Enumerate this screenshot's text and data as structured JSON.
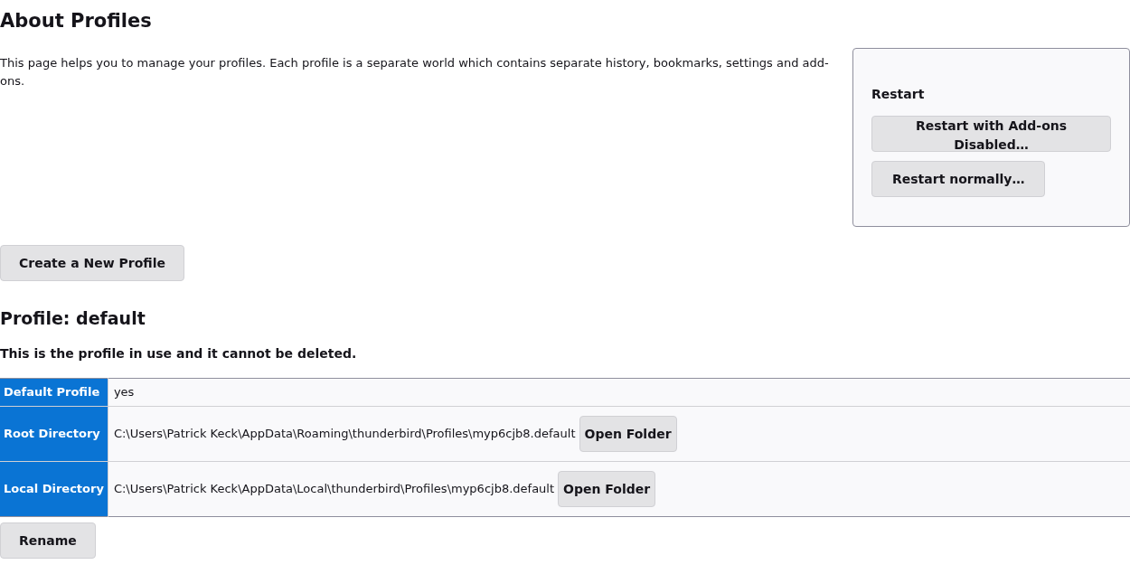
{
  "title": "About Profiles",
  "intro": "This page helps you to manage your profiles. Each profile is a separate world which contains separate history, bookmarks, settings and add-ons.",
  "restart": {
    "title": "Restart",
    "buttons": [
      "Restart with Add-ons Disabled…",
      "Restart normally…"
    ]
  },
  "create_button": "Create a New Profile",
  "profile": {
    "title": "Profile: default",
    "note": "This is the profile in use and it cannot be deleted.",
    "rows": [
      {
        "label": "Default Profile",
        "value": "yes"
      },
      {
        "label": "Root Directory",
        "value": "C:\\Users\\Patrick Keck\\AppData\\Roaming\\thunderbird\\Profiles\\myp6cjb8.default",
        "button": "Open Folder"
      },
      {
        "label": "Local Directory",
        "value": "C:\\Users\\Patrick Keck\\AppData\\Local\\thunderbird\\Profiles\\myp6cjb8.default",
        "button": "Open Folder"
      }
    ],
    "rename_button": "Rename"
  }
}
